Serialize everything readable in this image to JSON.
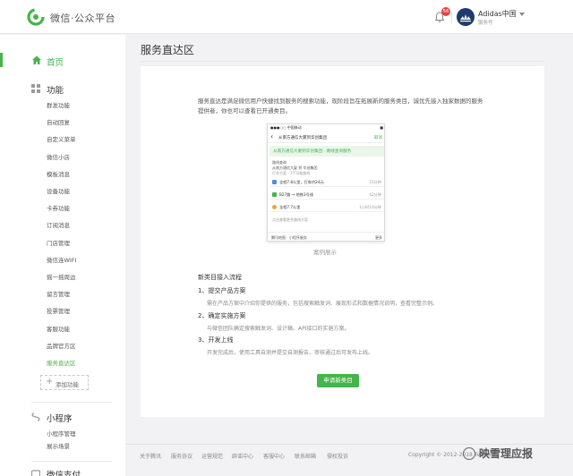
{
  "topbar": {
    "platform_name": "微信·公众平台",
    "notification_count": "56",
    "account_name": "Adidas中国",
    "account_type": "服务号"
  },
  "sidebar": {
    "home": "首页",
    "sections": [
      {
        "label": "功能",
        "items": [
          "群发功能",
          "自动回复",
          "自定义菜单",
          "微信小店",
          "模板消息",
          "设备功能",
          "卡券功能",
          "订阅消息",
          "门店管理",
          "微信连WIFI",
          "摇一摇周边",
          "留言管理",
          "投票管理",
          "客服功能",
          "品牌官方区",
          "服务直达区"
        ],
        "active_index": 15
      },
      {
        "label": "小程序",
        "items": [
          "小程序管理",
          "展示场景"
        ]
      },
      {
        "label": "微信支付"
      }
    ],
    "add_function": "添加功能"
  },
  "main": {
    "page_title": "服务直达区",
    "intro": "服务直达是满足微信用户快捷找到服务的搜索功能，现阶段旨在拓展新的服务类目，诚优先接入独家数据的服务提供者，你也可以查看已开通类目。",
    "example_caption": "案例展示",
    "phone": {
      "status_left": "●●●○○ 中国移动",
      "status_right": "■",
      "nav_title": "从南方通信大厦到华创集团",
      "nav_action": "取消",
      "banner": "从南方通信大厦到华创集团 - 路线查询服务",
      "route_label": "路线查询",
      "route_from": "从南方通信大厦 到 华创集团",
      "route_sub": "打车方案 · 7个可能路线",
      "rows": [
        {
          "text": "全程7.8公里，打车约24元",
          "time": "15分钟"
        },
        {
          "text": "B27路 → 地铁3号线",
          "time": "42分钟"
        },
        {
          "text": "全程7.7公里",
          "time": "1小时10分钟"
        }
      ],
      "more": "点击查看更多路线方案",
      "footer_left": "腾讯地图 · 小程序服务",
      "footer_right": "更多"
    },
    "flow_title": "新类目接入流程",
    "steps": [
      {
        "title": "1、提交产品方案",
        "desc": "需在产品方案中介绍你提供的服务，包括搜索触发词、展现形式和数据情况说明，查看完整示例。"
      },
      {
        "title": "2、确定实施方案",
        "desc": "与微信团队确定搜索触发词、设计稿、API接口的实施方案。"
      },
      {
        "title": "3、开发上线",
        "desc": "开发完成后，使用工具自测并提交自测报告，审核通过后可发布上线。"
      }
    ],
    "apply_button": "申请新类目"
  },
  "footer": {
    "links": [
      "关于腾讯",
      "服务协议",
      "运营规范",
      "辟谣中心",
      "客服中心",
      "联系邮箱",
      "侵权投诉"
    ],
    "copyright": "Copyright © 2012-2018 Tencent"
  },
  "watermark": "映雪理应报",
  "colors": {
    "brand_green": "#44b549",
    "badge_red": "#e64340"
  }
}
